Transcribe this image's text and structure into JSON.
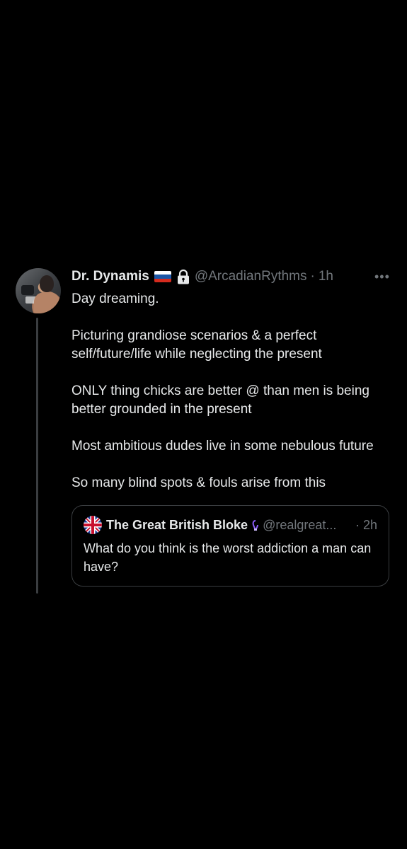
{
  "tweet": {
    "author": {
      "display_name": "Dr. Dynamis",
      "handle": "@ArcadianRythms",
      "time": "1h",
      "separator": "·",
      "flag_icon": "russia-flag-icon",
      "lock_icon": "lock-icon"
    },
    "more_icon": "•••",
    "paragraphs": [
      "Day dreaming.",
      "Picturing grandiose scenarios & a perfect self/future/life while neglecting the present",
      "ONLY thing chicks are better @ than men is being better grounded in the present",
      "Most ambitious dudes live in some nebulous future",
      "So many blind spots & fouls arise from this"
    ]
  },
  "quote": {
    "display_name": "The Great British Bloke",
    "handle": "@realgreat...",
    "separator": "·",
    "time": "2h",
    "text": "What do you think is the worst addiction a man can have?",
    "avatar_icon": "union-jack-icon"
  },
  "colors": {
    "background": "#000000",
    "primary_text": "#e7e9ea",
    "secondary_text": "#71767b",
    "border": "#3a3d40",
    "verified_purple": "#8a5cf6"
  }
}
